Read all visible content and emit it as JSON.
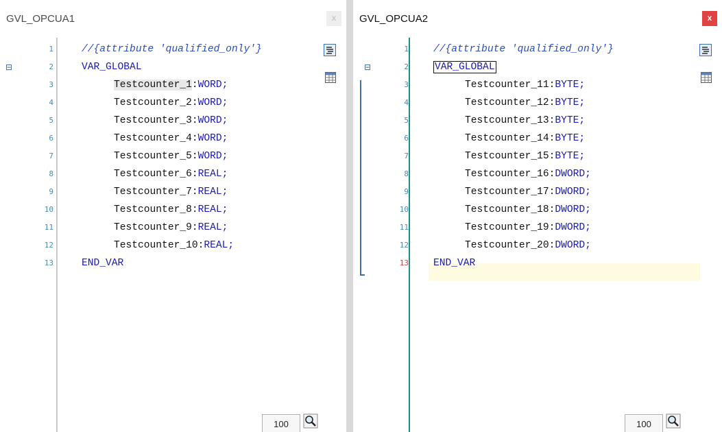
{
  "pane1": {
    "title": "GVL_OPCUA1",
    "close_label": "x",
    "line_numbers": [
      "1",
      "2",
      "3",
      "4",
      "5",
      "6",
      "7",
      "8",
      "9",
      "10",
      "11",
      "12",
      "13"
    ],
    "comment": "//{attribute 'qualified_only'}",
    "var_global": "VAR_GLOBAL",
    "end_var": "END_VAR",
    "vars": [
      {
        "name": "Testcounter_1",
        "sep": ":",
        "type": "WORD;"
      },
      {
        "name": "Testcounter_2",
        "sep": ":",
        "type": "WORD;"
      },
      {
        "name": "Testcounter_3",
        "sep": ":",
        "type": "WORD;"
      },
      {
        "name": "Testcounter_4",
        "sep": ":",
        "type": "WORD;"
      },
      {
        "name": "Testcounter_5",
        "sep": ":",
        "type": "WORD;"
      },
      {
        "name": "Testcounter_6",
        "sep": ":",
        "type": "REAL;"
      },
      {
        "name": "Testcounter_7",
        "sep": ":",
        "type": "REAL;"
      },
      {
        "name": "Testcounter_8",
        "sep": ":",
        "type": "REAL;"
      },
      {
        "name": "Testcounter_9",
        "sep": ":",
        "type": "REAL;"
      },
      {
        "name": "Testcounter_10",
        "sep": ":",
        "type": "REAL;"
      }
    ],
    "zoom": "100"
  },
  "pane2": {
    "title": "GVL_OPCUA2",
    "close_label": "x",
    "line_numbers": [
      "1",
      "2",
      "3",
      "4",
      "5",
      "6",
      "7",
      "8",
      "9",
      "10",
      "11",
      "12",
      "13"
    ],
    "comment": "//{attribute 'qualified_only'}",
    "var_global": "VAR_GLOBAL",
    "end_var": "END_VAR",
    "vars": [
      {
        "name": "Testcounter_11",
        "sep": ":",
        "type": "BYTE;"
      },
      {
        "name": "Testcounter_12",
        "sep": ":",
        "type": "BYTE;"
      },
      {
        "name": "Testcounter_13",
        "sep": ":",
        "type": "BYTE;"
      },
      {
        "name": "Testcounter_14",
        "sep": ":",
        "type": "BYTE;"
      },
      {
        "name": "Testcounter_15",
        "sep": ":",
        "type": "BYTE;"
      },
      {
        "name": "Testcounter_16",
        "sep": ":",
        "type": "DWORD;"
      },
      {
        "name": "Testcounter_17",
        "sep": ":",
        "type": "DWORD;"
      },
      {
        "name": "Testcounter_18",
        "sep": ":",
        "type": "DWORD;"
      },
      {
        "name": "Testcounter_19",
        "sep": ":",
        "type": "DWORD;"
      },
      {
        "name": "Testcounter_20",
        "sep": ":",
        "type": "DWORD;"
      }
    ],
    "zoom": "100"
  },
  "icons": {
    "fold": "collapse-icon",
    "textual_view": "textual-view-icon",
    "tabular_view": "tabular-view-icon",
    "zoom": "zoom-magnifier-icon"
  },
  "colors": {
    "keyword": "#1a1ab4",
    "comment": "#2a4dbb",
    "line_number": "#4a8ab0",
    "error_line_number": "#d04545",
    "close_active": "#e04343",
    "current_line": "#fffbe0"
  }
}
